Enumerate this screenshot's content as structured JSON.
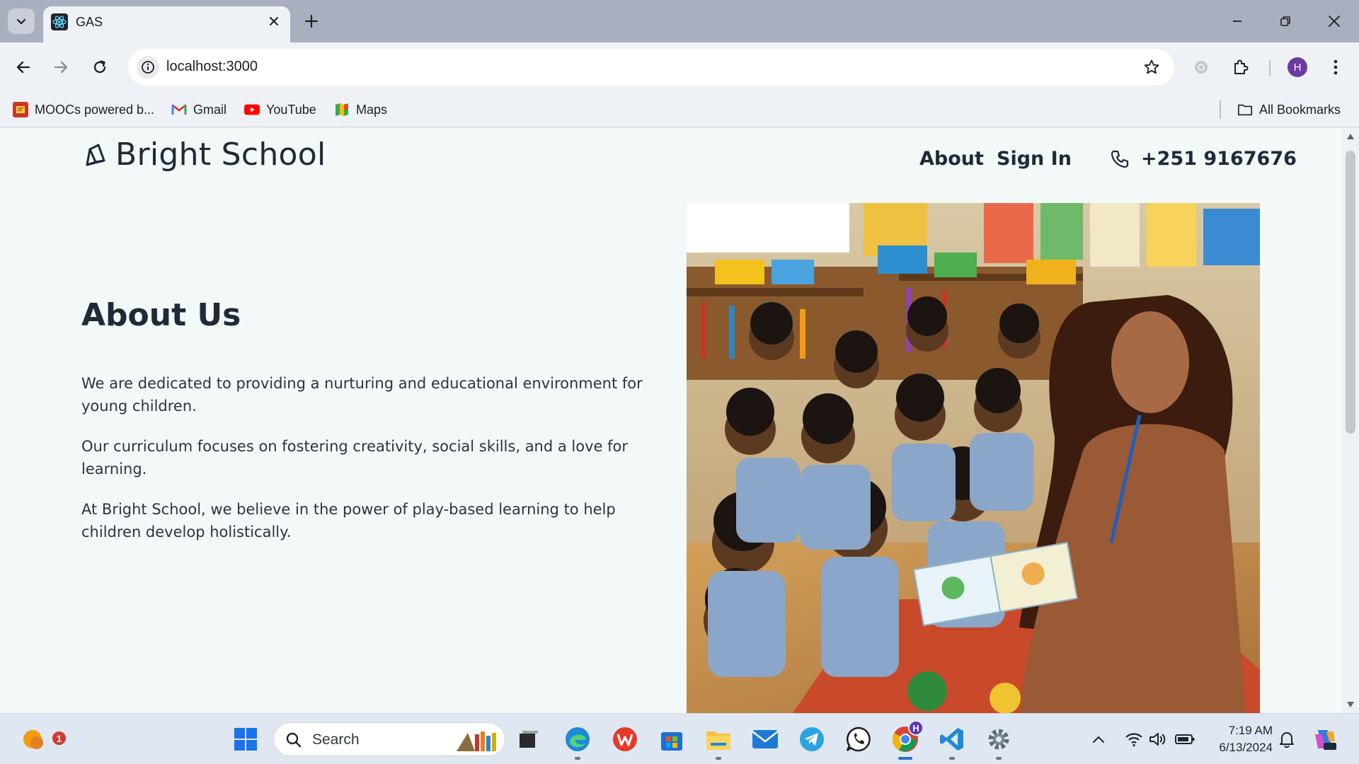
{
  "browser": {
    "tab_title": "GAS",
    "url": "localhost:3000",
    "profile_initial": "H",
    "bookmarks": [
      {
        "label": "MOOCs powered b...",
        "icon": "hpi-icon"
      },
      {
        "label": "Gmail",
        "icon": "gmail-icon"
      },
      {
        "label": "YouTube",
        "icon": "youtube-icon"
      },
      {
        "label": "Maps",
        "icon": "maps-icon"
      }
    ],
    "all_bookmarks": "All Bookmarks"
  },
  "site": {
    "brand": "Bright School",
    "nav": {
      "about": "About",
      "signin": "Sign In"
    },
    "phone": "+251 9167676"
  },
  "about": {
    "heading": "About Us",
    "paragraphs": [
      "We are dedicated to providing a nurturing and educational environment for young children.",
      "Our curriculum focuses on fostering creativity, social skills, and a love for learning.",
      "At Bright School, we believe in the power of play-based learning to help children develop holistically."
    ]
  },
  "taskbar": {
    "search_label": "Search",
    "notification_count": "1",
    "time": "7:19 AM",
    "date": "6/13/2024",
    "chrome_profile": "H"
  },
  "colors": {
    "page_bg": "#f3f8f8",
    "text_dark": "#1e2a38",
    "tab_strip": "#a8b0bf",
    "toolbar": "#eef1f6",
    "taskbar": "#dfe8f2"
  }
}
